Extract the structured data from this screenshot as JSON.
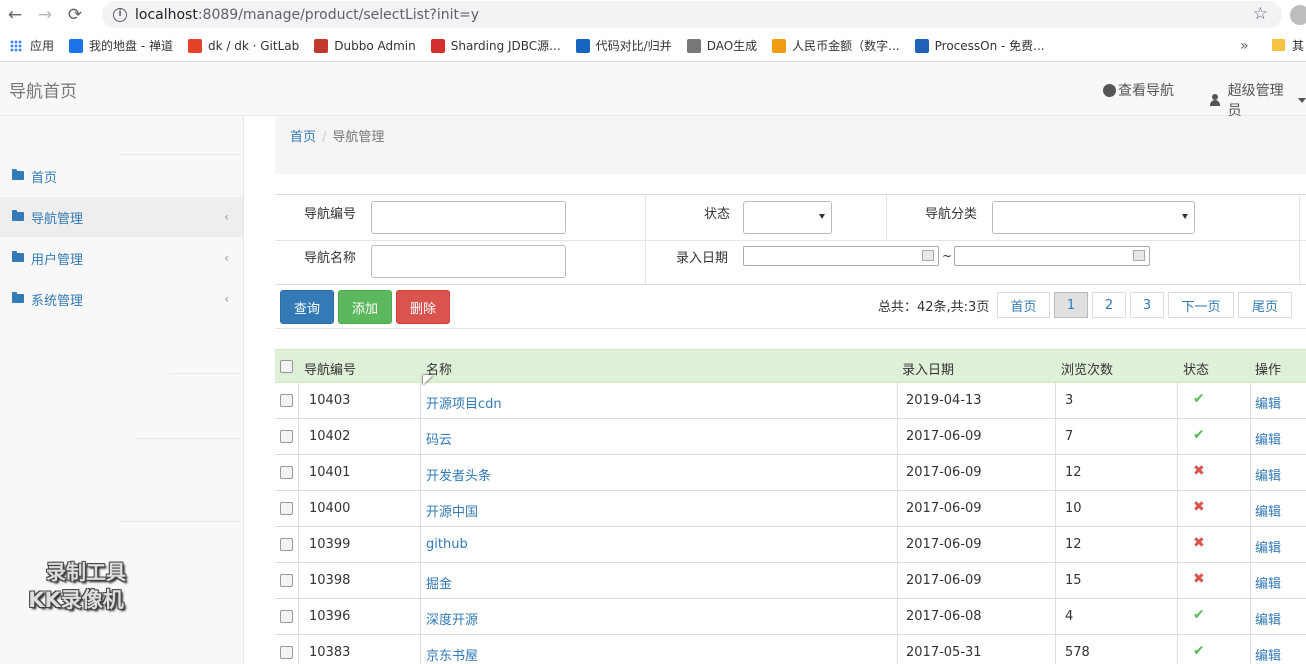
{
  "browser": {
    "url_host": "localhost",
    "url_path": ":8089/manage/product/selectList?init=y",
    "bookmarks": [
      {
        "label": "应用",
        "color": "#4285f4"
      },
      {
        "label": "我的地盘 - 禅道",
        "color": "#1a73e8"
      },
      {
        "label": "dk / dk · GitLab",
        "color": "#e24329"
      },
      {
        "label": "Dubbo Admin",
        "color": "#c0392b"
      },
      {
        "label": "Sharding JDBC源...",
        "color": "#d32f2f"
      },
      {
        "label": "代码对比/归并",
        "color": "#1565c0"
      },
      {
        "label": "DAO生成",
        "color": "#777777"
      },
      {
        "label": "人民币金额（数字...",
        "color": "#f39c12"
      },
      {
        "label": "ProcessOn - 免费...",
        "color": "#1e63b5"
      }
    ],
    "bookmarks_more": "»",
    "bookmarks_last": "其"
  },
  "header": {
    "brand": "导航首页",
    "view_nav": "查看导航",
    "user": "超级管理员"
  },
  "sidebar": {
    "items": [
      {
        "label": "首页"
      },
      {
        "label": "导航管理"
      },
      {
        "label": "用户管理"
      },
      {
        "label": "系统管理"
      }
    ]
  },
  "breadcrumb": {
    "home": "首页",
    "current": "导航管理"
  },
  "filter": {
    "nav_no_label": "导航编号",
    "status_label": "状态",
    "category_label": "导航分类",
    "nav_name_label": "导航名称",
    "date_label": "录入日期",
    "date_sep": "~"
  },
  "actions": {
    "query": "查询",
    "add": "添加",
    "delete": "删除"
  },
  "pagination": {
    "total": "总共：42条,共:3页",
    "first": "首页",
    "pages": [
      "1",
      "2",
      "3"
    ],
    "next": "下一页",
    "last": "尾页"
  },
  "table": {
    "headers": {
      "no": "导航编号",
      "name": "名称",
      "date": "录入日期",
      "views": "浏览次数",
      "status": "状态",
      "op": "操作"
    },
    "rows": [
      {
        "no": "10403",
        "name": "开源项目cdn",
        "date": "2019-04-13",
        "views": "3",
        "status": "ok",
        "op": "编辑"
      },
      {
        "no": "10402",
        "name": "码云",
        "date": "2017-06-09",
        "views": "7",
        "status": "ok",
        "op": "编辑"
      },
      {
        "no": "10401",
        "name": "开发者头条",
        "date": "2017-06-09",
        "views": "12",
        "status": "no",
        "op": "编辑"
      },
      {
        "no": "10400",
        "name": "开源中国",
        "date": "2017-06-09",
        "views": "10",
        "status": "no",
        "op": "编辑"
      },
      {
        "no": "10399",
        "name": "github",
        "date": "2017-06-09",
        "views": "12",
        "status": "no",
        "op": "编辑"
      },
      {
        "no": "10398",
        "name": "掘金",
        "date": "2017-06-09",
        "views": "15",
        "status": "no",
        "op": "编辑"
      },
      {
        "no": "10396",
        "name": "深度开源",
        "date": "2017-06-08",
        "views": "4",
        "status": "ok",
        "op": "编辑"
      },
      {
        "no": "10383",
        "name": "京东书屋",
        "date": "2017-05-31",
        "views": "578",
        "status": "ok",
        "op": "编辑"
      }
    ]
  },
  "watermark": {
    "line1": "录制工具",
    "line2": "KK录像机"
  }
}
